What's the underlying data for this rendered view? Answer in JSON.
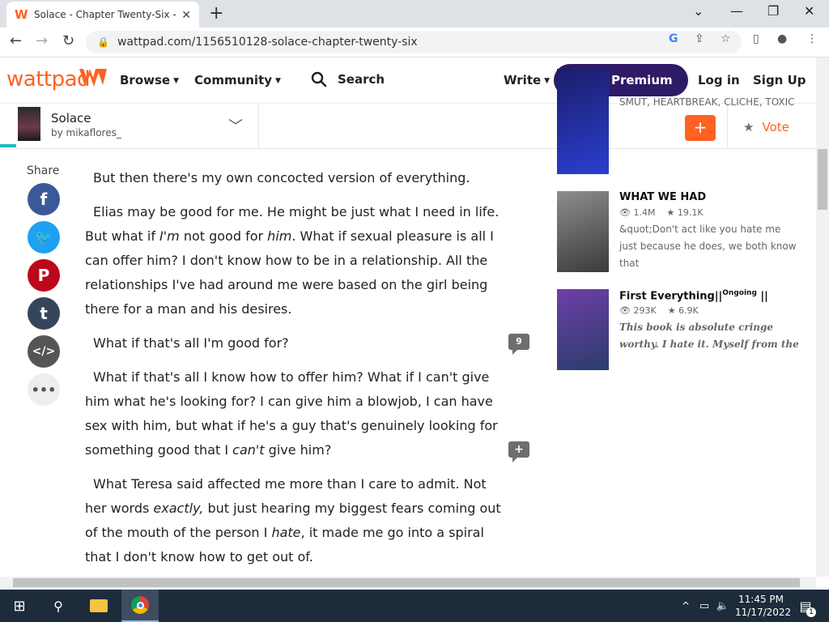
{
  "browser": {
    "tab_title": "Solace - Chapter Twenty-Six - W",
    "url": "wattpad.com/1156510128-solace-chapter-twenty-six"
  },
  "header": {
    "logo": "wattpad",
    "browse": "Browse",
    "community": "Community",
    "search": "Search",
    "write": "Write",
    "premium": "Try Premium",
    "login": "Log in",
    "signup": "Sign Up"
  },
  "story": {
    "title": "Solace",
    "author": "by mikaflores_",
    "add": "+",
    "vote": "Vote",
    "reading_progress": 0.02
  },
  "share": {
    "label": "Share",
    "items": [
      "facebook-icon",
      "twitter-icon",
      "pinterest-icon",
      "tumblr-icon",
      "embed-icon",
      "more-icon"
    ]
  },
  "paragraphs": [
    {
      "segments": [
        {
          "t": "But then there's my own concocted version of everything."
        }
      ]
    },
    {
      "segments": [
        {
          "t": "Elias may be good for me. He might be just what I need in life. But what if "
        },
        {
          "t": "I'm",
          "i": true
        },
        {
          "t": " not good for "
        },
        {
          "t": "him",
          "i": true
        },
        {
          "t": ". What if sexual pleasure is all I can offer him? I don't know how to be in a relationship. All the relationships I've had around me were based on the girl being there for a man and his desires."
        }
      ]
    },
    {
      "segments": [
        {
          "t": "What if that's all I'm good for?"
        }
      ]
    },
    {
      "segments": [
        {
          "t": "What if that's all I know how to offer him? What if I can't give him what he's looking for? I can give him a blowjob, I can have sex with him, but what if he's a guy that's genuinely looking for something good that I "
        },
        {
          "t": "can't",
          "i": true
        },
        {
          "t": " give him?"
        }
      ]
    },
    {
      "segments": [
        {
          "t": "What Teresa said affected me more than I care to admit. Not her words "
        },
        {
          "t": "exactly,",
          "i": true
        },
        {
          "t": " but just hearing my biggest fears coming out of the mouth of the person I "
        },
        {
          "t": "hate",
          "i": true
        },
        {
          "t": ", it made me go into a spiral that I don't know how to get out of."
        }
      ]
    }
  ],
  "comments": {
    "count_1": "9",
    "add_2": "+"
  },
  "recommendations": [
    {
      "title": "",
      "reads": "",
      "votes": "",
      "desc": "SMUT, HEARTBREAK, CLICHE, TOXIC",
      "cover": [
        "#1b1e6b",
        "#2a3fd0"
      ]
    },
    {
      "title": "WHAT WE HAD",
      "reads": "1.4M",
      "votes": "19.1K",
      "desc": "&quot;Don't act like you hate me just because he does, we both know that",
      "cover": [
        "#8d8d8d",
        "#3a3a3a"
      ]
    },
    {
      "title": "First Everything",
      "title_sup": "Ongoing",
      "title_suffix": "||",
      "reads": "293K",
      "votes": "6.9K",
      "desc": "This book is absolute cringe worthy. I hate it. Myself from the",
      "cover": [
        "#6e3fa8",
        "#2a3d6b"
      ]
    }
  ],
  "taskbar": {
    "time": "11:45 PM",
    "date": "11/17/2022",
    "notif": "1"
  }
}
